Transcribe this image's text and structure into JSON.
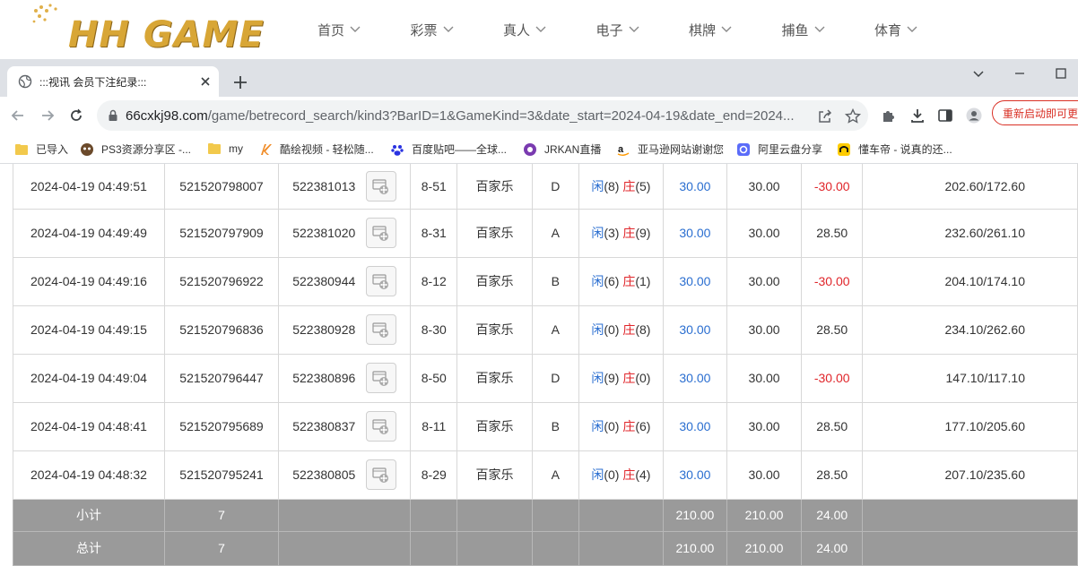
{
  "site": {
    "logo_text": "HH GAME",
    "nav": [
      {
        "label": "首页"
      },
      {
        "label": "彩票"
      },
      {
        "label": "真人"
      },
      {
        "label": "电子"
      },
      {
        "label": "棋牌"
      },
      {
        "label": "捕鱼"
      },
      {
        "label": "体育"
      }
    ]
  },
  "browser": {
    "tab_title": ":::视讯 会员下注纪录:::",
    "url_host": "66cxkj98.com",
    "url_path": "/game/betrecord_search/kind3?BarID=1&GameKind=3&date_start=2024-04-19&date_end=2024...",
    "restart_label": "重新启动即可更新",
    "bookmarks": [
      {
        "label": "已导入",
        "icon": "folder-icon"
      },
      {
        "label": "PS3资源分享区 -...",
        "icon": "ps3-icon"
      },
      {
        "label": "my",
        "icon": "folder-icon"
      },
      {
        "label": "酷绘视频 - 轻松随...",
        "icon": "k-icon"
      },
      {
        "label": "百度贴吧——全球...",
        "icon": "baidu-icon"
      },
      {
        "label": "JRKAN直播",
        "icon": "jrkan-icon"
      },
      {
        "label": "亚马逊网站谢谢您",
        "icon": "amazon-icon"
      },
      {
        "label": "阿里云盘分享",
        "icon": "aliyun-icon"
      },
      {
        "label": "懂车帝 - 说真的还...",
        "icon": "dongchedi-icon"
      }
    ]
  },
  "colors": {
    "accent_blue": "#2a6ed0",
    "loss_red": "#e0252a",
    "total_row_bg": "#9a9a9a",
    "logo_gold": "#d8a636"
  },
  "records": [
    {
      "time": "2024-04-19 04:49:51",
      "bet_id": "521520798007",
      "round_id": "522381013",
      "table": "8-51",
      "game": "百家乐",
      "bet": "D",
      "xian_label": "闲",
      "xian": "(8)",
      "zhuang_label": "庄",
      "zhuang": "(5)",
      "bet_amount": "30.00",
      "valid_amount": "30.00",
      "payout": "-30.00",
      "payout_neg": true,
      "balance": "202.60/172.60"
    },
    {
      "time": "2024-04-19 04:49:49",
      "bet_id": "521520797909",
      "round_id": "522381020",
      "table": "8-31",
      "game": "百家乐",
      "bet": "A",
      "xian_label": "闲",
      "xian": "(3)",
      "zhuang_label": "庄",
      "zhuang": "(9)",
      "bet_amount": "30.00",
      "valid_amount": "30.00",
      "payout": "28.50",
      "payout_neg": false,
      "balance": "232.60/261.10"
    },
    {
      "time": "2024-04-19 04:49:16",
      "bet_id": "521520796922",
      "round_id": "522380944",
      "table": "8-12",
      "game": "百家乐",
      "bet": "B",
      "xian_label": "闲",
      "xian": "(6)",
      "zhuang_label": "庄",
      "zhuang": "(1)",
      "bet_amount": "30.00",
      "valid_amount": "30.00",
      "payout": "-30.00",
      "payout_neg": true,
      "balance": "204.10/174.10"
    },
    {
      "time": "2024-04-19 04:49:15",
      "bet_id": "521520796836",
      "round_id": "522380928",
      "table": "8-30",
      "game": "百家乐",
      "bet": "A",
      "xian_label": "闲",
      "xian": "(0)",
      "zhuang_label": "庄",
      "zhuang": "(8)",
      "bet_amount": "30.00",
      "valid_amount": "30.00",
      "payout": "28.50",
      "payout_neg": false,
      "balance": "234.10/262.60"
    },
    {
      "time": "2024-04-19 04:49:04",
      "bet_id": "521520796447",
      "round_id": "522380896",
      "table": "8-50",
      "game": "百家乐",
      "bet": "D",
      "xian_label": "闲",
      "xian": "(9)",
      "zhuang_label": "庄",
      "zhuang": "(0)",
      "bet_amount": "30.00",
      "valid_amount": "30.00",
      "payout": "-30.00",
      "payout_neg": true,
      "balance": "147.10/117.10"
    },
    {
      "time": "2024-04-19 04:48:41",
      "bet_id": "521520795689",
      "round_id": "522380837",
      "table": "8-11",
      "game": "百家乐",
      "bet": "B",
      "xian_label": "闲",
      "xian": "(0)",
      "zhuang_label": "庄",
      "zhuang": "(6)",
      "bet_amount": "30.00",
      "valid_amount": "30.00",
      "payout": "28.50",
      "payout_neg": false,
      "balance": "177.10/205.60"
    },
    {
      "time": "2024-04-19 04:48:32",
      "bet_id": "521520795241",
      "round_id": "522380805",
      "table": "8-29",
      "game": "百家乐",
      "bet": "A",
      "xian_label": "闲",
      "xian": "(0)",
      "zhuang_label": "庄",
      "zhuang": "(4)",
      "bet_amount": "30.00",
      "valid_amount": "30.00",
      "payout": "28.50",
      "payout_neg": false,
      "balance": "207.10/235.60"
    }
  ],
  "totals": [
    {
      "label": "小计",
      "count": "7",
      "bet_amount": "210.00",
      "valid_amount": "210.00",
      "payout": "24.00"
    },
    {
      "label": "总计",
      "count": "7",
      "bet_amount": "210.00",
      "valid_amount": "210.00",
      "payout": "24.00"
    }
  ]
}
